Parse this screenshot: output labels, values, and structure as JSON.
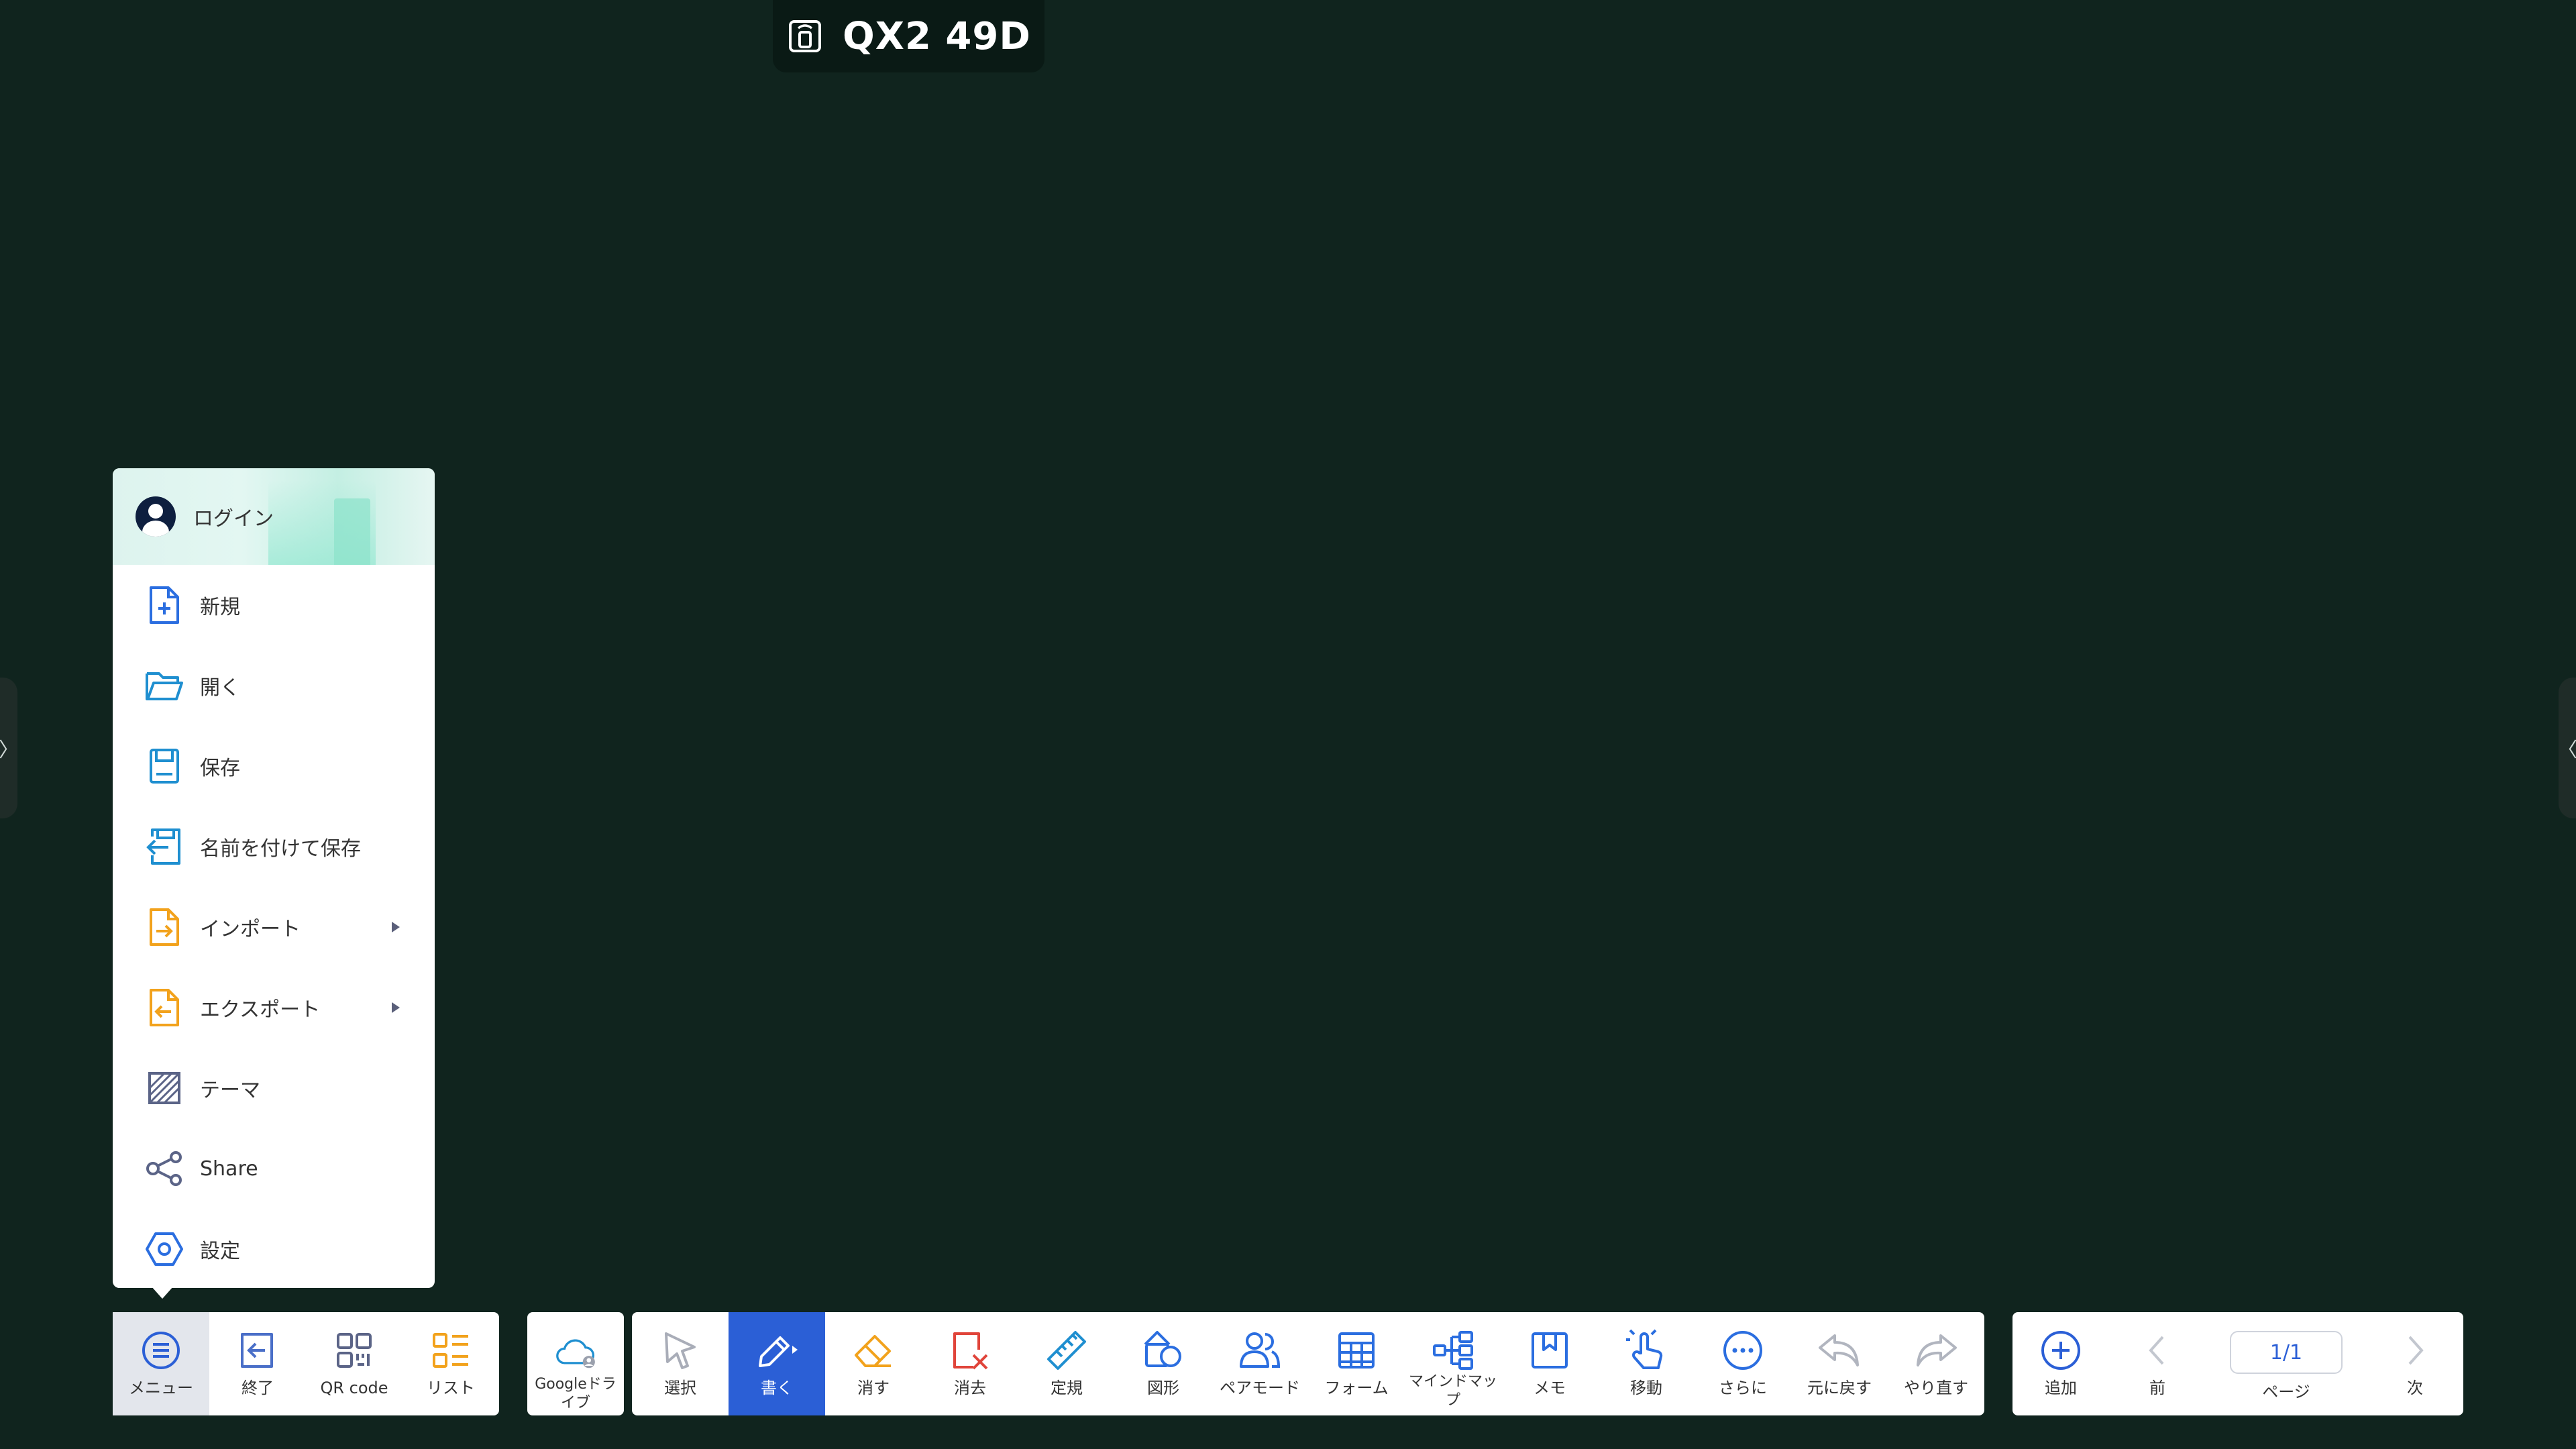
{
  "header": {
    "device_name": "QX2 49D",
    "icon": "screen-share-icon"
  },
  "side_handles": {
    "left": "〉",
    "right": "〈"
  },
  "menu": {
    "login_label": "ログイン",
    "items": [
      {
        "label": "新規",
        "icon": "new-file-icon",
        "color": "#2b6ee0"
      },
      {
        "label": "開く",
        "icon": "folder-open-icon",
        "color": "#1f8fd0"
      },
      {
        "label": "保存",
        "icon": "save-icon",
        "color": "#1f8fd0"
      },
      {
        "label": "名前を付けて保存",
        "icon": "save-as-icon",
        "color": "#1f8fd0"
      },
      {
        "label": "インポート",
        "icon": "import-icon",
        "color": "#f2a21c",
        "submenu": true
      },
      {
        "label": "エクスポート",
        "icon": "export-icon",
        "color": "#f2a21c",
        "submenu": true
      },
      {
        "label": "テーマ",
        "icon": "theme-icon",
        "color": "#5b6487"
      },
      {
        "label": "Share",
        "icon": "share-icon",
        "color": "#5b6487"
      },
      {
        "label": "設定",
        "icon": "settings-icon",
        "color": "#2b6ee0"
      }
    ]
  },
  "toolbar_left": {
    "menu": "メニュー",
    "exit": "終了",
    "qr": "QR code",
    "list": "リスト"
  },
  "toolbar_drive": {
    "label": "Googleドライブ"
  },
  "toolbar_main": {
    "select": "選択",
    "write": "書く",
    "erase": "消す",
    "clear": "消去",
    "ruler": "定規",
    "shape": "図形",
    "pair": "ペアモード",
    "form": "フォーム",
    "mindmap": "マインドマップ",
    "memo": "メモ",
    "move": "移動",
    "more": "さらに",
    "undo": "元に戻す",
    "redo": "やり直す"
  },
  "toolbar_right": {
    "add": "追加",
    "prev": "前",
    "page_value": "1/1",
    "page_label": "ページ",
    "next": "次"
  },
  "colors": {
    "background": "#10241e",
    "accent": "#2b5fd6",
    "orange": "#f2a21c",
    "red": "#e0443a"
  }
}
